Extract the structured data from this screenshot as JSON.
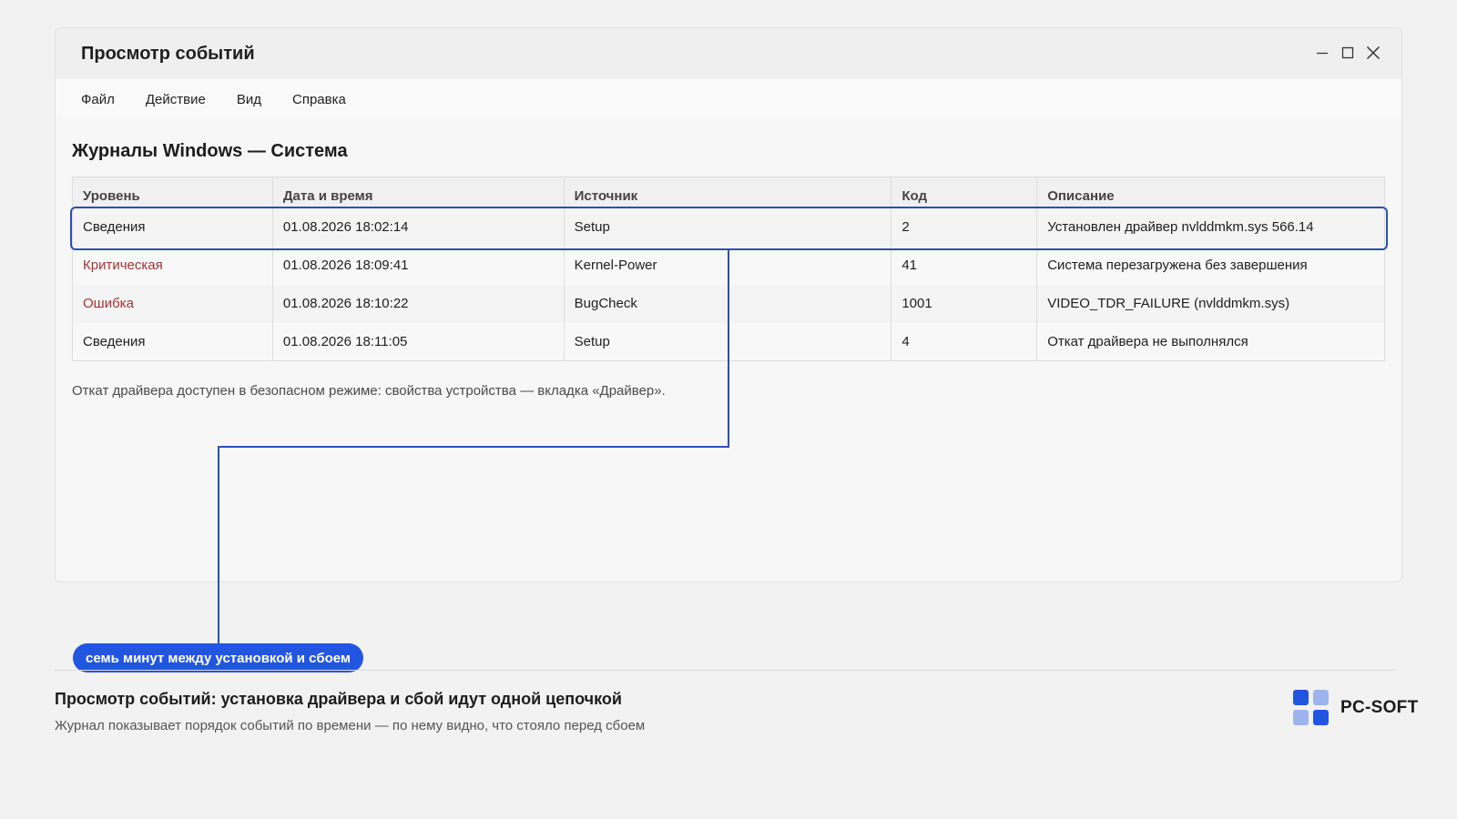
{
  "window": {
    "title": "Просмотр событий",
    "controls": [
      "minimize-icon",
      "maximize-icon",
      "close-icon"
    ]
  },
  "menu": {
    "items": [
      {
        "label": "Файл"
      },
      {
        "label": "Действие"
      },
      {
        "label": "Вид"
      },
      {
        "label": "Справка"
      }
    ]
  },
  "main": {
    "section_title": "Журналы Windows — Система",
    "table": {
      "headers": [
        "Уровень",
        "Дата и время",
        "Источник",
        "Код",
        "Описание"
      ],
      "rows": [
        {
          "level": "Сведения",
          "datetime": "01.08.2026 18:02:14",
          "source": "Setup",
          "code": "2",
          "description": "Установлен драйвер nvlddmkm.sys 566.14",
          "highlighted": true
        },
        {
          "level": "Критическая",
          "datetime": "01.08.2026 18:09:41",
          "source": "Kernel-Power",
          "code": "41",
          "description": "Система перезагружена без завершения"
        },
        {
          "level": "Ошибка",
          "datetime": "01.08.2026 18:10:22",
          "source": "BugCheck",
          "code": "1001",
          "description": "VIDEO_TDR_FAILURE (nvlddmkm.sys)"
        },
        {
          "level": "Сведения",
          "datetime": "01.08.2026 18:11:05",
          "source": "Setup",
          "code": "4",
          "description": "Откат драйвера не выполнялся"
        }
      ]
    },
    "note": "Откат драйвера доступен в безопасном режиме: свойства устройства — вкладка «Драйвер»."
  },
  "annotation": {
    "callout": "семь минут между установкой и сбоем"
  },
  "footer": {
    "title": "Просмотр событий: установка драйвера и сбой идут одной цепочкой",
    "subtitle": "Журнал показывает порядок событий по времени — по нему видно, что стояло перед сбоем",
    "brand": "PC-SOFT"
  },
  "colors": {
    "accent": "#2256e0",
    "highlight_border": "#2a4fb8",
    "critical_text": "#a83232",
    "logo_dark": "#2256e0",
    "logo_light": "#9db3ee"
  }
}
